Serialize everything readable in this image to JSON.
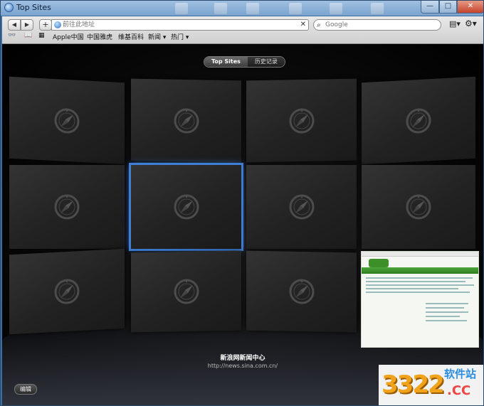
{
  "window": {
    "title": "Top Sites"
  },
  "toolbar": {
    "back_glyph": "◀",
    "forward_glyph": "▶",
    "add_glyph": "+",
    "address_placeholder": "前往此地址",
    "clear_glyph": "✕",
    "search_placeholder": "Google",
    "page_menu_glyph": "▤▾",
    "gear_glyph": "⚙▾"
  },
  "bookmarks": {
    "reading_glyph": "👓",
    "book_glyph": "📖",
    "grid_glyph": "▦",
    "items": [
      "Apple中国",
      "中国雅虎",
      "维基百科",
      "新闻 ▾",
      "热门 ▾"
    ]
  },
  "topsites": {
    "tabs": [
      "Top Sites",
      "历史记录"
    ],
    "selected_tab": "Top Sites",
    "hover_title": "新浪网新闻中心",
    "hover_url": "http://news.sina.com.cn/",
    "edit_label": "编辑"
  },
  "watermark": {
    "number": "3322",
    "cn": "软件站",
    "cc": ".CC"
  }
}
